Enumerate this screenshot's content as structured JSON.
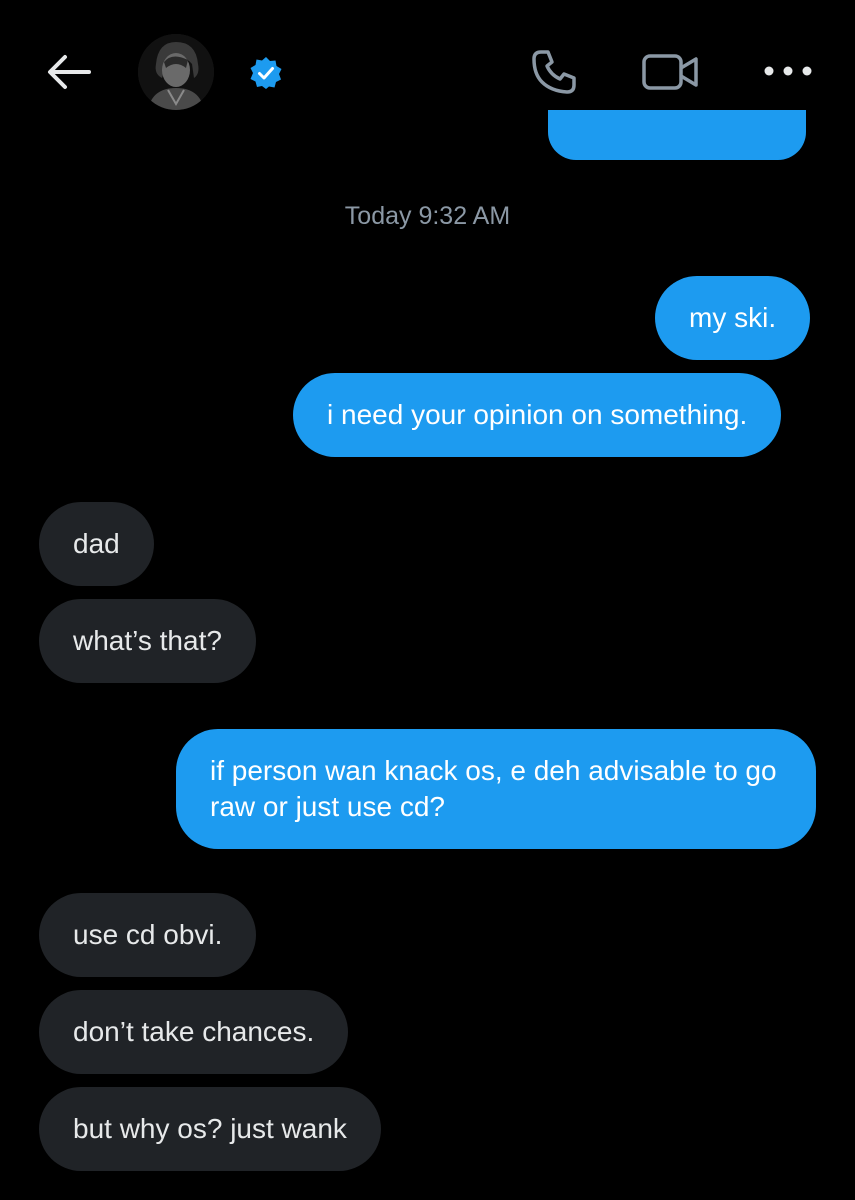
{
  "header": {
    "back_icon": "arrow-left-icon",
    "avatar_alt": "contact avatar",
    "verified_icon": "verified-badge-icon",
    "call_icon": "phone-icon",
    "video_icon": "video-camera-icon",
    "more_icon": "more-horizontal-icon"
  },
  "colors": {
    "background": "#000000",
    "outgoing_bubble": "#1d9bf0",
    "incoming_bubble": "#202327",
    "timestamp": "#8b98a5",
    "icons": "#e7e9ea",
    "icons_muted": "#8b98a5"
  },
  "timestamp": "Today 9:32 AM",
  "messages": [
    {
      "direction": "out",
      "text": "my ski."
    },
    {
      "direction": "out",
      "text": "i need your opinion on something."
    },
    {
      "direction": "in",
      "text": "dad"
    },
    {
      "direction": "in",
      "text": "what’s that?"
    },
    {
      "direction": "out",
      "text": "if person wan knack os, e deh advisable to go raw or just use cd?"
    },
    {
      "direction": "in",
      "text": "use cd obvi."
    },
    {
      "direction": "in",
      "text": "don’t take chances."
    },
    {
      "direction": "in",
      "text": "but why os? just wank"
    }
  ]
}
